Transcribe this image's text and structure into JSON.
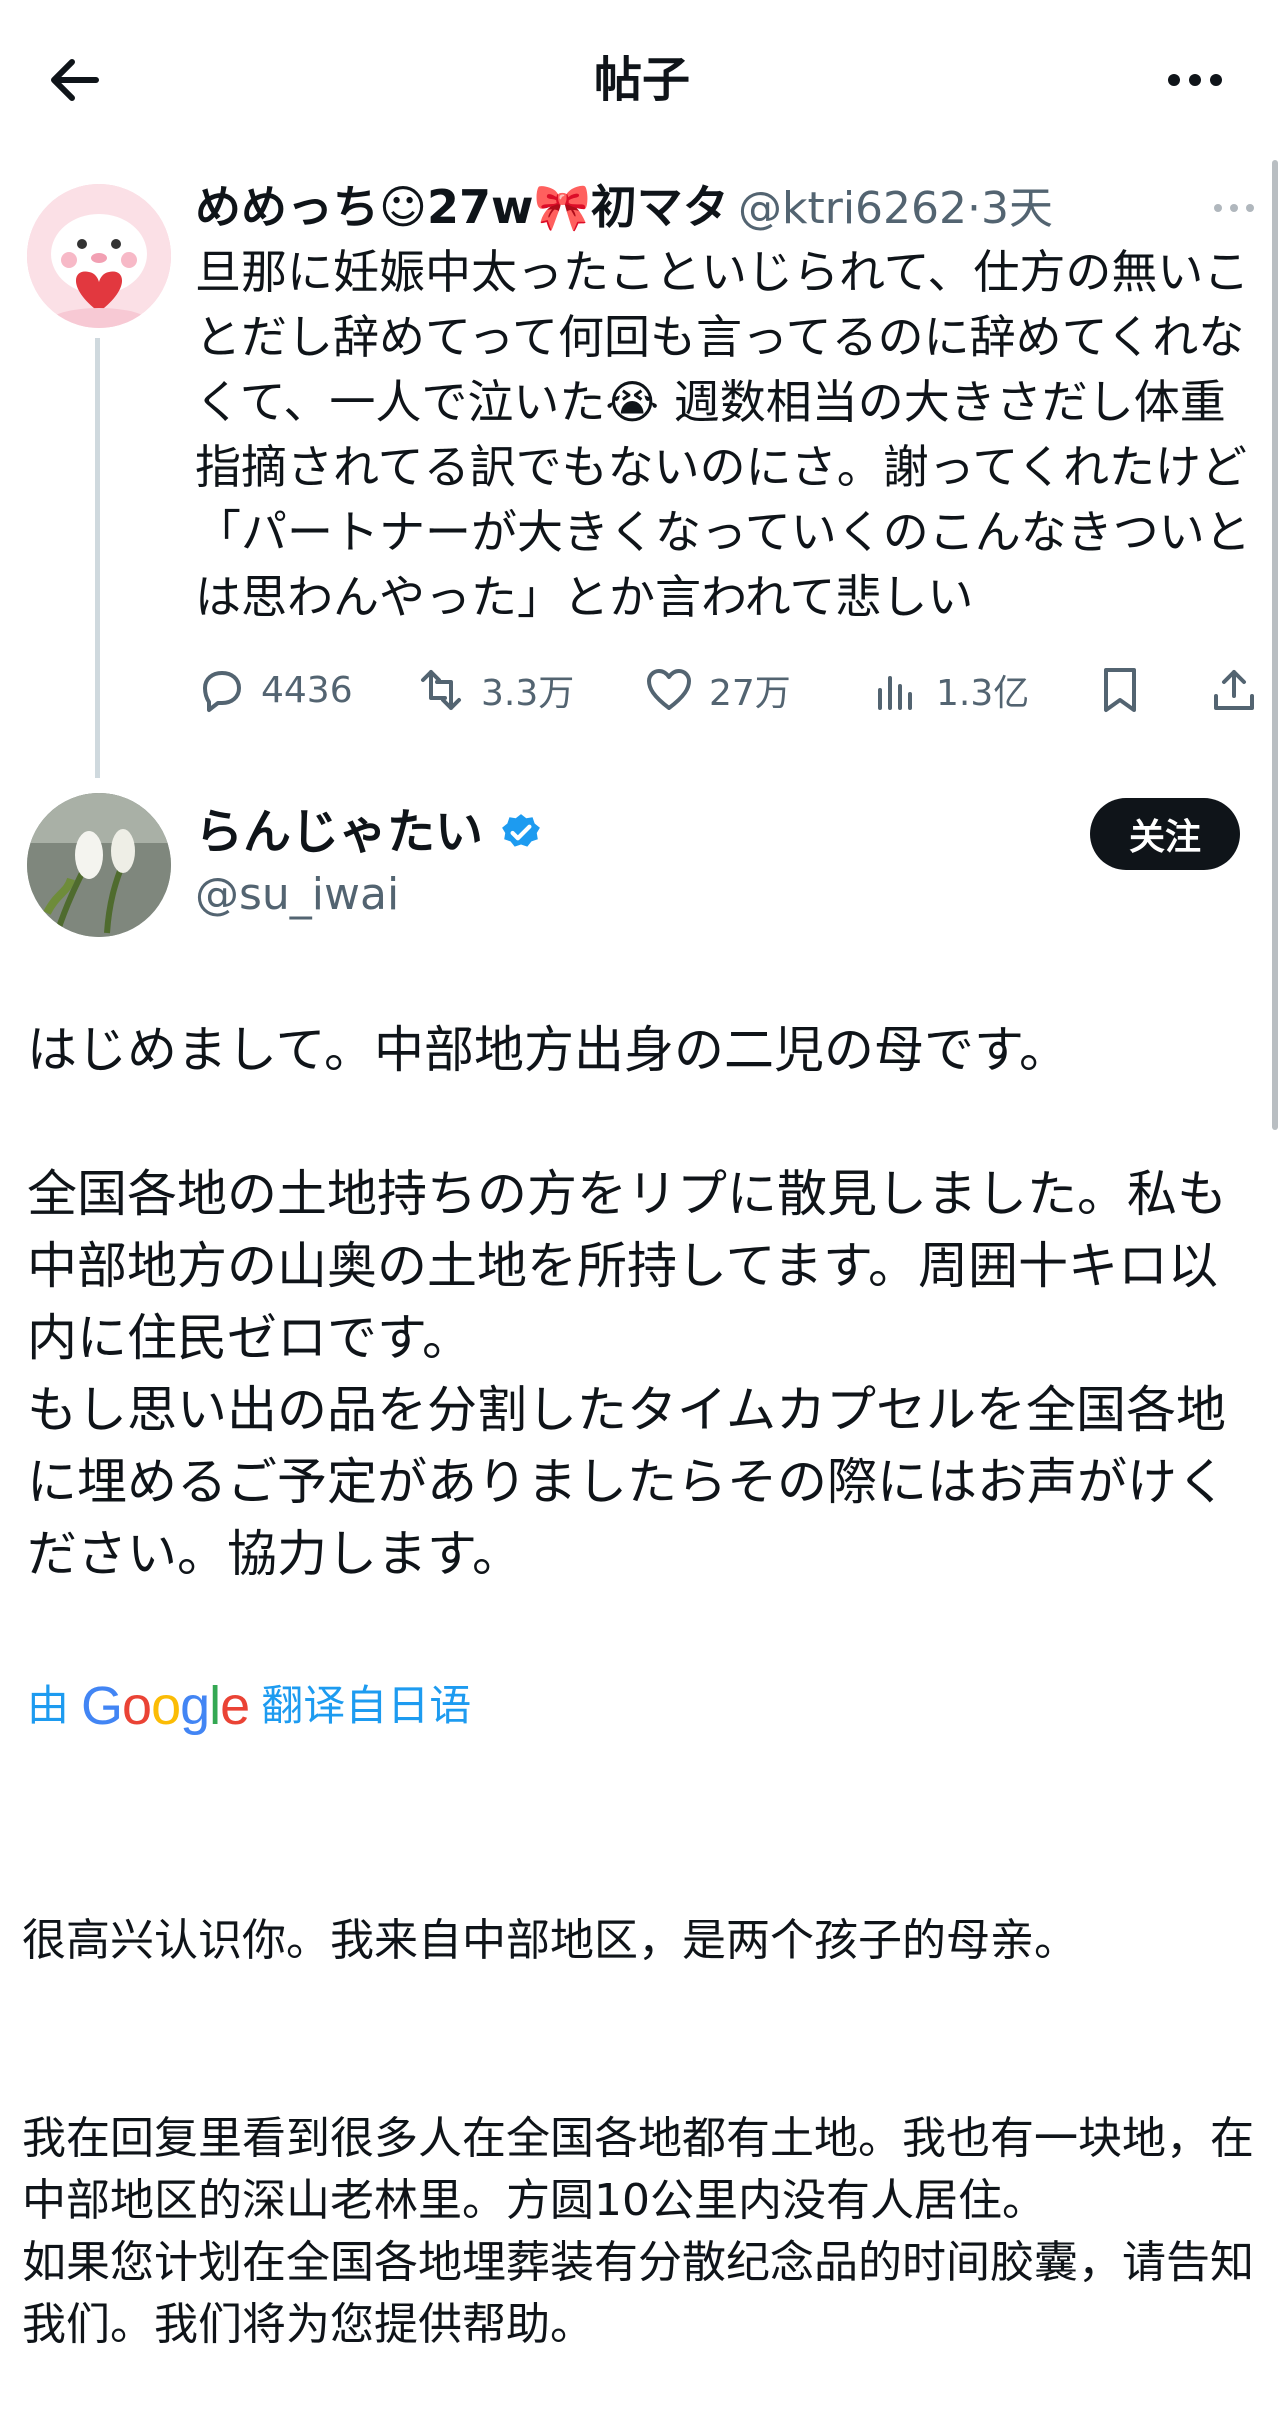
{
  "header": {
    "title": "帖子"
  },
  "quoted_post": {
    "display_name": "めめっち☺27w🎀初マタ",
    "handle": "@ktri6262",
    "age": "3天",
    "text": "旦那に妊娠中太ったこといじられて、仕方の無いことだし辞めてって何回も言ってるのに辞めてくれなくて、一人で泣いた😭 週数相当の大きさだし体重指摘されてる訳でもないのにさ。謝ってくれたけど「パートナーが大きくなっていくのこんなきついとは思わんやった」とか言われて悲しい",
    "replies": "4436",
    "reposts": "3.3万",
    "likes": "27万",
    "views": "1.3亿"
  },
  "main_post": {
    "display_name": "らんじゃたい",
    "handle": "@su_iwai",
    "follow_label": "关注",
    "text": "はじめまして。中部地方出身の二児の母です。\n\n全国各地の土地持ちの方をリプに散見しました。私も中部地方の山奥の土地を所持してます。周囲十キロ以内に住民ゼロです。\nもし思い出の品を分割したタイムカプセルを全国各地に埋めるご予定がありましたらその際にはお声がけください。協力します。",
    "translation": {
      "prefix": "由",
      "provider": "Google",
      "suffix": "翻译自日语",
      "paragraph1": "很高兴认识你。我来自中部地区，是两个孩子的母亲。",
      "paragraph2": "我在回复里看到很多人在全国各地都有土地。我也有一块地，在中部地区的深山老林里。方圆10公里内没有人居住。\n如果您计划在全国各地埋葬装有分散纪念品的时间胶囊，请告知我们。我们将为您提供帮助。"
    }
  },
  "colors": {
    "accent": "#1d9bf0",
    "muted": "#536471",
    "verified": "#1d9bf0"
  }
}
